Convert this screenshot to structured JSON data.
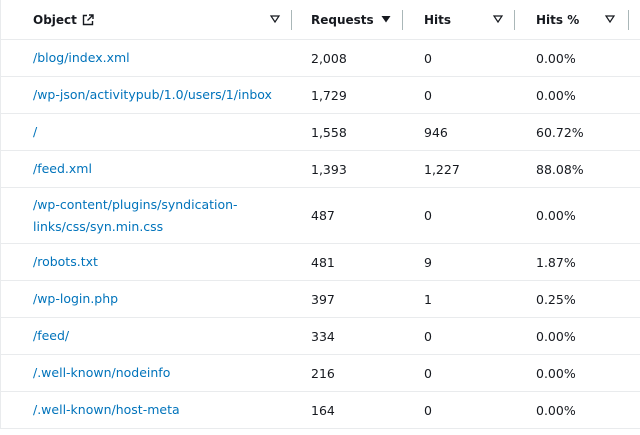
{
  "columns": {
    "object": "Object",
    "requests": "Requests",
    "hits": "Hits",
    "hits_pct": "Hits %"
  },
  "rows": [
    {
      "object": "/blog/index.xml",
      "requests": "2,008",
      "hits": "0",
      "hits_pct": "0.00%"
    },
    {
      "object": "/wp-json/activitypub/1.0/users/1/inbox",
      "requests": "1,729",
      "hits": "0",
      "hits_pct": "0.00%"
    },
    {
      "object": "/",
      "requests": "1,558",
      "hits": "946",
      "hits_pct": "60.72%"
    },
    {
      "object": "/feed.xml",
      "requests": "1,393",
      "hits": "1,227",
      "hits_pct": "88.08%"
    },
    {
      "object": "/wp-content/plugins/syndication-links/css/syn.min.css",
      "object_line1": "/wp-content/plugins/syndication-",
      "object_line2": "links/css/syn.min.css",
      "requests": "487",
      "hits": "0",
      "hits_pct": "0.00%"
    },
    {
      "object": "/robots.txt",
      "requests": "481",
      "hits": "9",
      "hits_pct": "1.87%"
    },
    {
      "object": "/wp-login.php",
      "requests": "397",
      "hits": "1",
      "hits_pct": "0.25%"
    },
    {
      "object": "/feed/",
      "requests": "334",
      "hits": "0",
      "hits_pct": "0.00%"
    },
    {
      "object": "/.well-known/nodeinfo",
      "requests": "216",
      "hits": "0",
      "hits_pct": "0.00%"
    },
    {
      "object": "/.well-known/host-meta",
      "requests": "164",
      "hits": "0",
      "hits_pct": "0.00%"
    }
  ],
  "icons": {
    "external_link": "external-link-icon",
    "sort_unsorted": "caret-down-outline-icon",
    "sort_active": "caret-down-filled-icon"
  },
  "colors": {
    "link": "#0073bb",
    "text": "#16191f",
    "divider": "#aab7b8",
    "row_border": "#e9ebed"
  }
}
